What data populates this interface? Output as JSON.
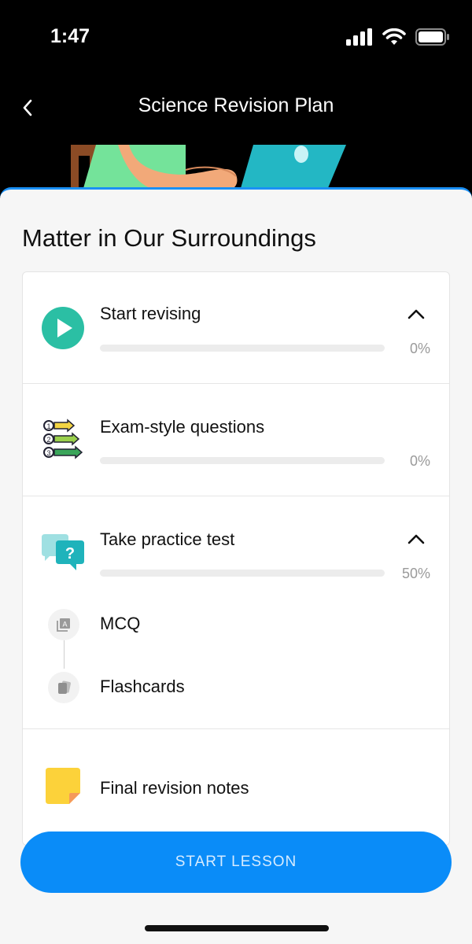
{
  "status_bar": {
    "time": "1:47",
    "icons": [
      "signal-icon",
      "wifi-icon",
      "battery-icon"
    ]
  },
  "header": {
    "title": "Science Revision Plan",
    "back_icon": "chevron-left-icon"
  },
  "chapter": {
    "title": "Matter in Our Surroundings"
  },
  "items": [
    {
      "title": "Start revising",
      "progress": "0%",
      "progress_value": 0,
      "icon": "play-icon",
      "expanded": true
    },
    {
      "title": "Exam-style questions",
      "progress": "0%",
      "progress_value": 0,
      "icon": "numbered-steps-icon"
    },
    {
      "title": "Take practice test",
      "progress": "50%",
      "progress_value": 50,
      "icon": "question-chat-icon",
      "expanded": true,
      "sub_items": [
        {
          "label": "MCQ",
          "icon": "mcq-icon"
        },
        {
          "label": "Flashcards",
          "icon": "flashcards-icon"
        }
      ]
    },
    {
      "title": "Final revision notes",
      "icon": "sticky-note-icon"
    }
  ],
  "cta": {
    "label": "START LESSON"
  },
  "colors": {
    "accent": "#0a8cf8",
    "teal": "#2bbfa4",
    "sheet_bg": "#f6f6f6"
  }
}
